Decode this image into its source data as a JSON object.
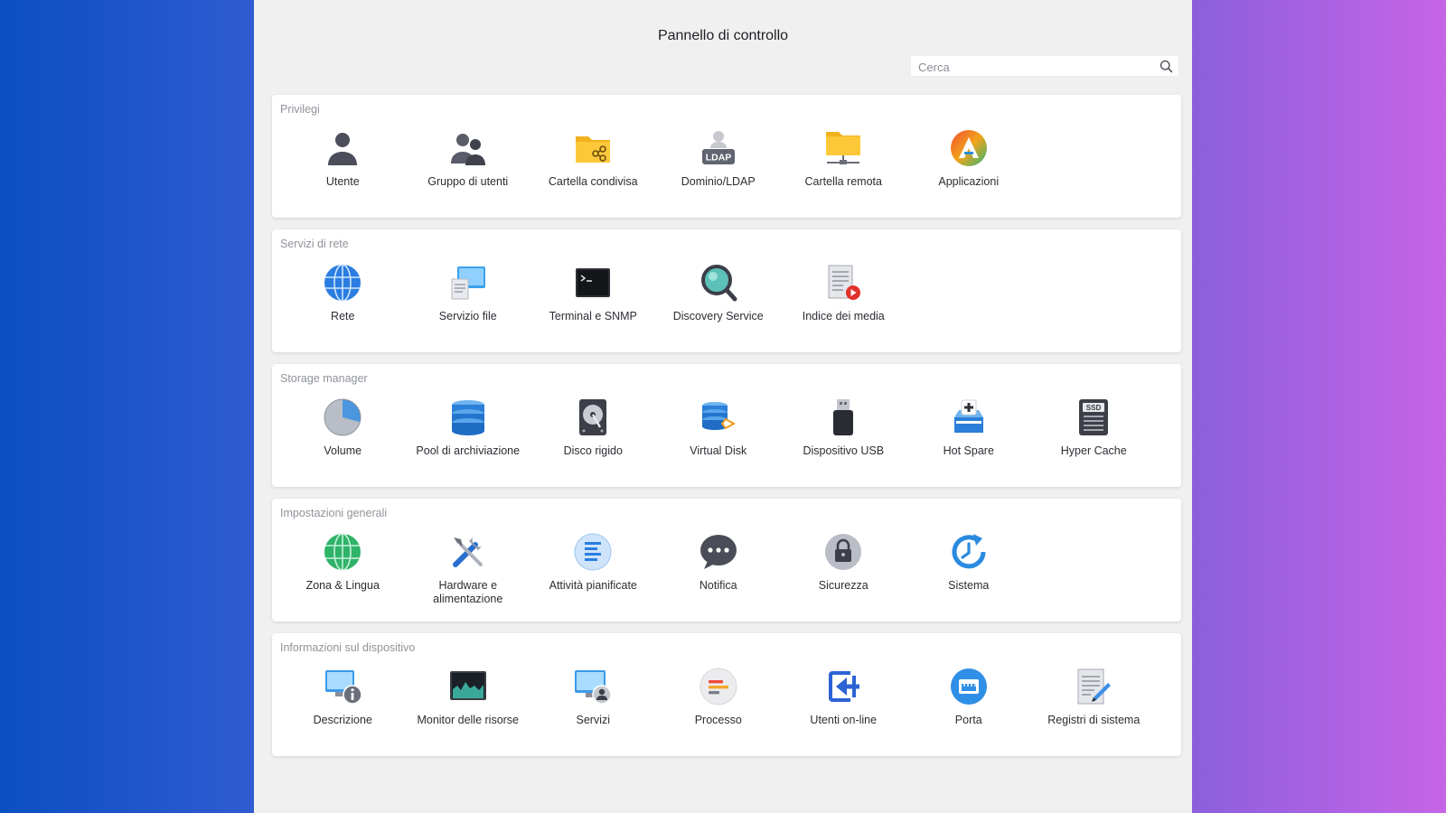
{
  "app": {
    "title": "Pannello di controllo"
  },
  "search": {
    "placeholder": "Cerca",
    "value": ""
  },
  "sections": [
    {
      "title": "Privilegi",
      "items": [
        {
          "label": "Utente",
          "icon": "user-icon"
        },
        {
          "label": "Gruppo di utenti",
          "icon": "user-group-icon"
        },
        {
          "label": "Cartella condivisa",
          "icon": "shared-folder-icon"
        },
        {
          "label": "Dominio/LDAP",
          "icon": "ldap-icon",
          "icon_text": "LDAP"
        },
        {
          "label": "Cartella remota",
          "icon": "remote-folder-icon"
        },
        {
          "label": "Applicazioni",
          "icon": "applications-icon"
        }
      ]
    },
    {
      "title": "Servizi di rete",
      "items": [
        {
          "label": "Rete",
          "icon": "globe-network-icon"
        },
        {
          "label": "Servizio file",
          "icon": "file-service-icon"
        },
        {
          "label": "Terminal e SNMP",
          "icon": "terminal-icon"
        },
        {
          "label": "Discovery Service",
          "icon": "magnifier-icon"
        },
        {
          "label": "Indice dei media",
          "icon": "media-index-icon"
        }
      ]
    },
    {
      "title": "Storage manager",
      "items": [
        {
          "label": "Volume",
          "icon": "volume-pie-icon"
        },
        {
          "label": "Pool di archiviazione",
          "icon": "storage-pool-icon"
        },
        {
          "label": "Disco rigido",
          "icon": "hard-disk-icon"
        },
        {
          "label": "Virtual Disk",
          "icon": "virtual-disk-icon"
        },
        {
          "label": "Dispositivo USB",
          "icon": "usb-device-icon"
        },
        {
          "label": "Hot Spare",
          "icon": "hot-spare-icon"
        },
        {
          "label": "Hyper Cache",
          "icon": "ssd-cache-icon",
          "icon_text": "SSD"
        }
      ]
    },
    {
      "title": "Impostazioni generali",
      "items": [
        {
          "label": "Zona & Lingua",
          "icon": "globe-region-icon"
        },
        {
          "label": "Hardware e alimentazione",
          "icon": "tools-icon"
        },
        {
          "label": "Attività pianificate",
          "icon": "scheduled-tasks-icon"
        },
        {
          "label": "Notifica",
          "icon": "chat-bubble-icon"
        },
        {
          "label": "Sicurezza",
          "icon": "lock-icon"
        },
        {
          "label": "Sistema",
          "icon": "system-clock-icon"
        }
      ]
    },
    {
      "title": "Informazioni sul dispositivo",
      "items": [
        {
          "label": "Descrizione",
          "icon": "info-monitor-icon"
        },
        {
          "label": "Monitor delle risorse",
          "icon": "resource-monitor-icon"
        },
        {
          "label": "Servizi",
          "icon": "services-monitor-icon"
        },
        {
          "label": "Processo",
          "icon": "process-icon"
        },
        {
          "label": "Utenti on-line",
          "icon": "online-users-icon"
        },
        {
          "label": "Porta",
          "icon": "port-icon"
        },
        {
          "label": "Registri di sistema",
          "icon": "system-logs-icon"
        }
      ]
    }
  ]
}
